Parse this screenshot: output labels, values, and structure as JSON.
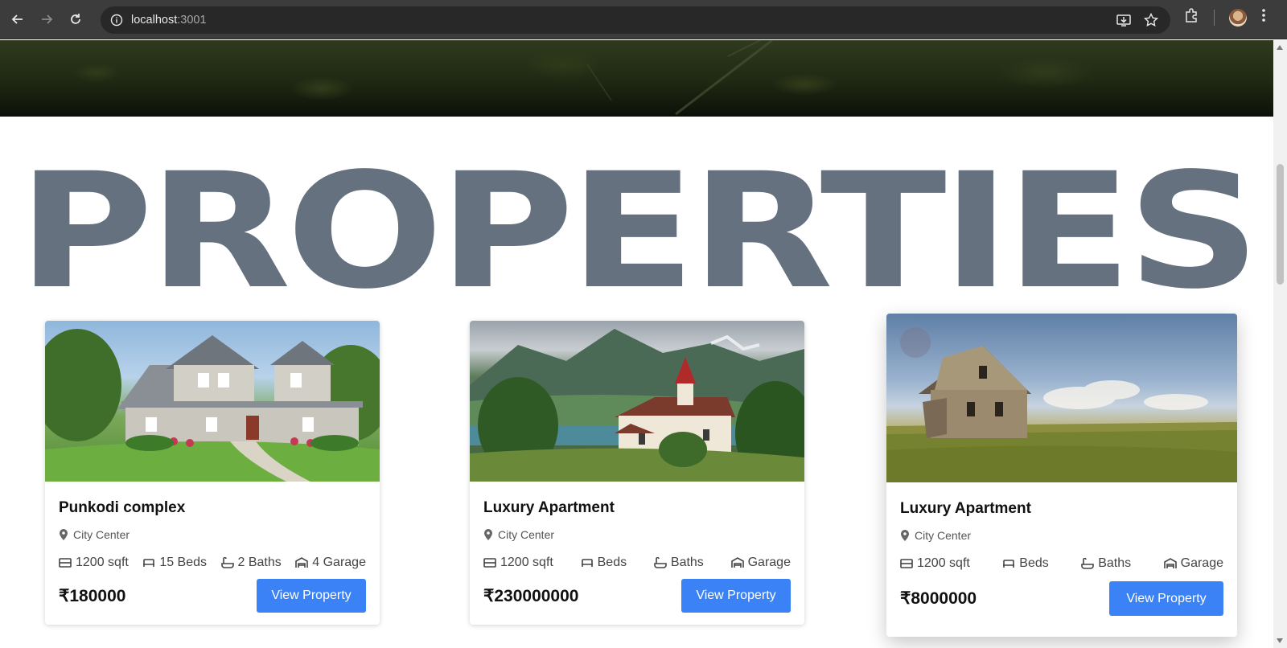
{
  "browser": {
    "url_host": "localhost",
    "url_port": ":3001"
  },
  "page": {
    "heading": "PROPERTIES"
  },
  "properties": [
    {
      "title": "Punkodi complex",
      "location": "City Center",
      "sqft": "1200 sqft",
      "beds": "15 Beds",
      "baths": "2 Baths",
      "garage": "4 Garage",
      "price": "₹180000",
      "button": "View Property"
    },
    {
      "title": "Luxury Apartment",
      "location": "City Center",
      "sqft": "1200 sqft",
      "beds": "Beds",
      "baths": "Baths",
      "garage": "Garage",
      "price": "₹230000000",
      "button": "View Property"
    },
    {
      "title": "Luxury Apartment",
      "location": "City Center",
      "sqft": "1200 sqft",
      "beds": "Beds",
      "baths": "Baths",
      "garage": "Garage",
      "price": "₹8000000",
      "button": "View Property"
    }
  ],
  "colors": {
    "accent": "#3b82f6",
    "heading": "#667180"
  }
}
